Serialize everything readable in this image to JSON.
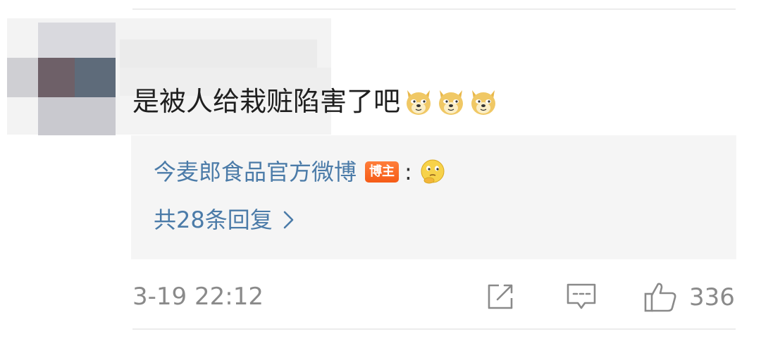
{
  "comment": {
    "text": "是被人给栽赃陷害了吧",
    "emojis": [
      "doge-icon",
      "doge-icon",
      "doge-icon"
    ],
    "timestamp": "3-19 22:12",
    "like_count": "336"
  },
  "reply_preview": {
    "author": "今麦郎食品官方微博",
    "badge": "博主",
    "colon": ":",
    "emoji": "thinking-face-icon",
    "reply_count_label": "共28条回复"
  },
  "colors": {
    "link_blue": "#4b7ba8",
    "badge_orange": "#f55b16",
    "meta_gray": "#8a8a8a",
    "reply_bg": "#f5f5f5"
  }
}
